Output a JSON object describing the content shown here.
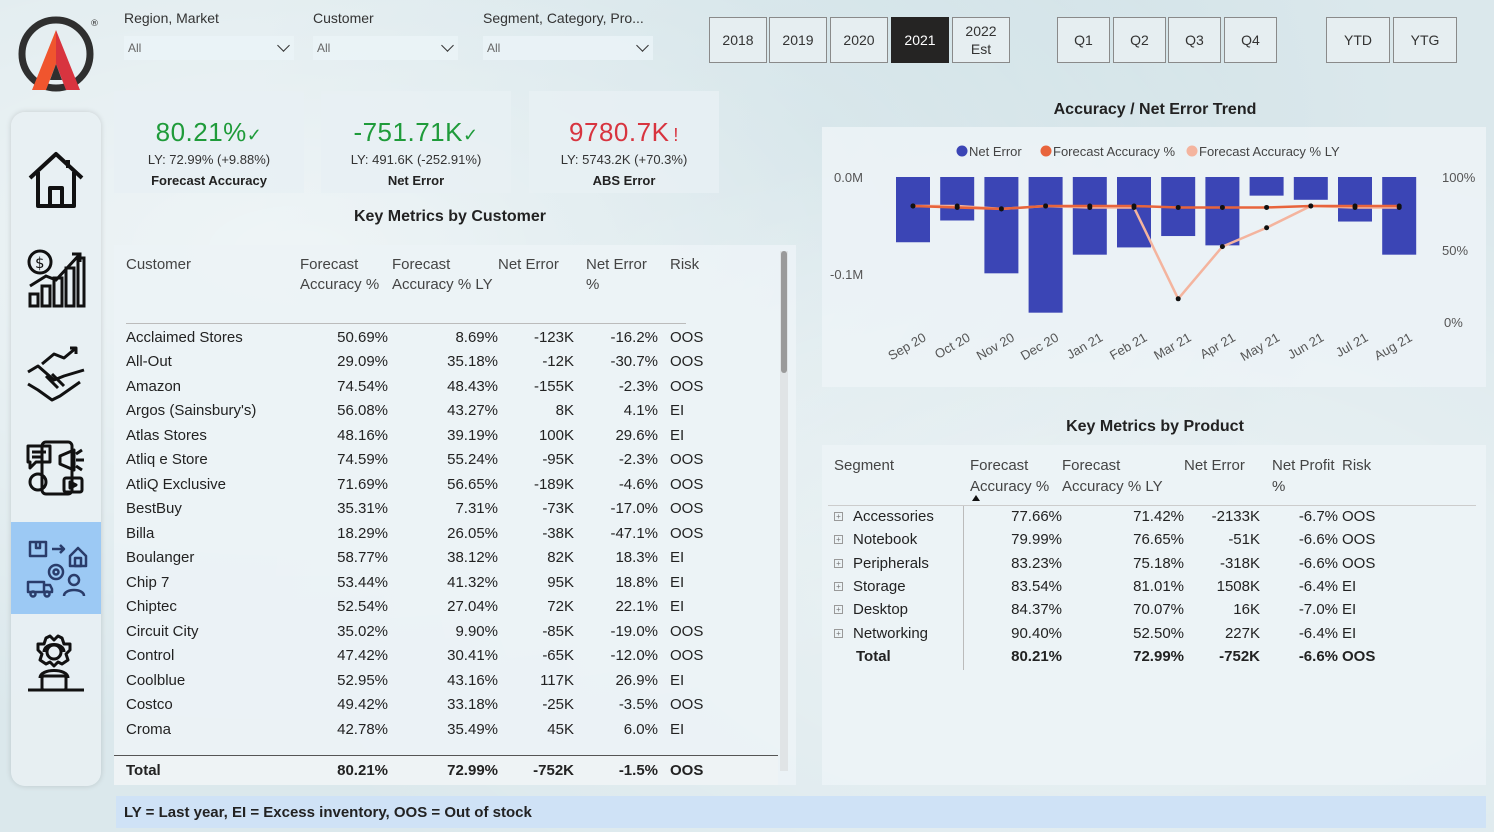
{
  "filters": [
    {
      "label": "Region, Market",
      "value": "All"
    },
    {
      "label": "Customer",
      "value": "All"
    },
    {
      "label": "Segment, Category, Pro...",
      "value": "All"
    }
  ],
  "years": [
    {
      "label": "2018",
      "active": false
    },
    {
      "label": "2019",
      "active": false
    },
    {
      "label": "2020",
      "active": false
    },
    {
      "label": "2021",
      "active": true
    },
    {
      "label": "2022\nEst",
      "active": false
    }
  ],
  "quarters": [
    "Q1",
    "Q2",
    "Q3",
    "Q4"
  ],
  "periods": [
    "YTD",
    "YTG"
  ],
  "nav": [
    "home-icon",
    "finance-growth-icon",
    "handshake-icon",
    "marketing-icon",
    "supply-chain-icon",
    "support-agent-icon"
  ],
  "kpis": [
    {
      "value": "80.21%",
      "mark": "✓",
      "ly": "LY: 72.99% (+9.88%)",
      "label": "Forecast Accuracy",
      "color": "#1f9b3a"
    },
    {
      "value": "-751.71K",
      "mark": "✓",
      "ly": "LY: 491.6K (-252.91%)",
      "label": "Net Error",
      "color": "#1f9b3a"
    },
    {
      "value": "9780.7K",
      "mark": "!",
      "ly": "LY: 5743.2K (+70.3%)",
      "label": "ABS Error",
      "color": "#d8343f"
    }
  ],
  "customer_table": {
    "title": "Key Metrics by Customer",
    "headers": [
      "Customer",
      "Forecast Accuracy %",
      "Forecast Accuracy % LY",
      "Net Error",
      "Net Error %",
      "Risk"
    ],
    "rows": [
      [
        "Acclaimed Stores",
        "50.69%",
        "8.69%",
        "-123K",
        "-16.2%",
        "OOS"
      ],
      [
        "All-Out",
        "29.09%",
        "35.18%",
        "-12K",
        "-30.7%",
        "OOS"
      ],
      [
        "Amazon",
        "74.54%",
        "48.43%",
        "-155K",
        "-2.3%",
        "OOS"
      ],
      [
        "Argos (Sainsbury's)",
        "56.08%",
        "43.27%",
        "8K",
        "4.1%",
        "EI"
      ],
      [
        "Atlas Stores",
        "48.16%",
        "39.19%",
        "100K",
        "29.6%",
        "EI"
      ],
      [
        "Atliq e Store",
        "74.59%",
        "55.24%",
        "-95K",
        "-2.3%",
        "OOS"
      ],
      [
        "AtliQ Exclusive",
        "71.69%",
        "56.65%",
        "-189K",
        "-4.6%",
        "OOS"
      ],
      [
        "BestBuy",
        "35.31%",
        "7.31%",
        "-73K",
        "-17.0%",
        "OOS"
      ],
      [
        "Billa",
        "18.29%",
        "26.05%",
        "-38K",
        "-47.1%",
        "OOS"
      ],
      [
        "Boulanger",
        "58.77%",
        "38.12%",
        "82K",
        "18.3%",
        "EI"
      ],
      [
        "Chip 7",
        "53.44%",
        "41.32%",
        "95K",
        "18.8%",
        "EI"
      ],
      [
        "Chiptec",
        "52.54%",
        "27.04%",
        "72K",
        "22.1%",
        "EI"
      ],
      [
        "Circuit City",
        "35.02%",
        "9.90%",
        "-85K",
        "-19.0%",
        "OOS"
      ],
      [
        "Control",
        "47.42%",
        "30.41%",
        "-65K",
        "-12.0%",
        "OOS"
      ],
      [
        "Coolblue",
        "52.95%",
        "43.16%",
        "117K",
        "26.9%",
        "EI"
      ],
      [
        "Costco",
        "49.42%",
        "33.18%",
        "-25K",
        "-3.5%",
        "OOS"
      ],
      [
        "Croma",
        "42.78%",
        "35.49%",
        "45K",
        "6.0%",
        "EI"
      ]
    ],
    "total": [
      "Total",
      "80.21%",
      "72.99%",
      "-752K",
      "-1.5%",
      "OOS"
    ]
  },
  "chart_data": {
    "type": "bar+line",
    "title": "Accuracy / Net Error Trend",
    "categories": [
      "Sep 20",
      "Oct 20",
      "Nov 20",
      "Dec 20",
      "Jan 21",
      "Feb 21",
      "Mar 21",
      "Apr 21",
      "May 21",
      "Jun 21",
      "Jul 21",
      "Aug 21"
    ],
    "legend": [
      {
        "name": "Net Error",
        "color": "#3b45b5"
      },
      {
        "name": "Forecast Accuracy %",
        "color": "#e8643c"
      },
      {
        "name": "Forecast Accuracy % LY",
        "color": "#f4b49e"
      }
    ],
    "series": [
      {
        "name": "Net Error",
        "axis": "left",
        "values": [
          -0.063,
          -0.042,
          -0.093,
          -0.131,
          -0.075,
          -0.068,
          -0.057,
          -0.066,
          -0.018,
          -0.022,
          -0.043,
          -0.075
        ]
      },
      {
        "name": "Forecast Accuracy %",
        "axis": "right",
        "values": [
          80,
          79,
          78,
          80,
          80,
          80,
          79,
          79,
          79,
          80,
          80,
          80
        ]
      },
      {
        "name": "Forecast Accuracy % LY",
        "axis": "right",
        "values": [
          80,
          80,
          78,
          80,
          79,
          79,
          16,
          52,
          65,
          80,
          79,
          79
        ]
      }
    ],
    "left_axis": {
      "ticks": [
        "0.0M",
        "-0.1M"
      ],
      "range": [
        -0.14,
        0
      ]
    },
    "right_axis": {
      "ticks": [
        "100%",
        "50%",
        "0%"
      ],
      "range": [
        0,
        100
      ]
    },
    "legend_position": "top"
  },
  "product_table": {
    "title": "Key Metrics by Product",
    "headers": [
      "Segment",
      "Forecast Accuracy %",
      "Forecast Accuracy % LY",
      "Net Error",
      "Net Profit %",
      "Risk"
    ],
    "rows": [
      [
        "Accessories",
        "77.66%",
        "71.42%",
        "-2133K",
        "-6.7%",
        "OOS"
      ],
      [
        "Notebook",
        "79.99%",
        "76.65%",
        "-51K",
        "-6.6%",
        "OOS"
      ],
      [
        "Peripherals",
        "83.23%",
        "75.18%",
        "-318K",
        "-6.6%",
        "OOS"
      ],
      [
        "Storage",
        "83.54%",
        "81.01%",
        "1508K",
        "-6.4%",
        "EI"
      ],
      [
        "Desktop",
        "84.37%",
        "70.07%",
        "16K",
        "-7.0%",
        "EI"
      ],
      [
        "Networking",
        "90.40%",
        "52.50%",
        "227K",
        "-6.4%",
        "EI"
      ]
    ],
    "total": [
      "Total",
      "80.21%",
      "72.99%",
      "-752K",
      "-6.6%",
      "OOS"
    ]
  },
  "footer": "LY = Last year, EI = Excess inventory, OOS = Out of stock"
}
